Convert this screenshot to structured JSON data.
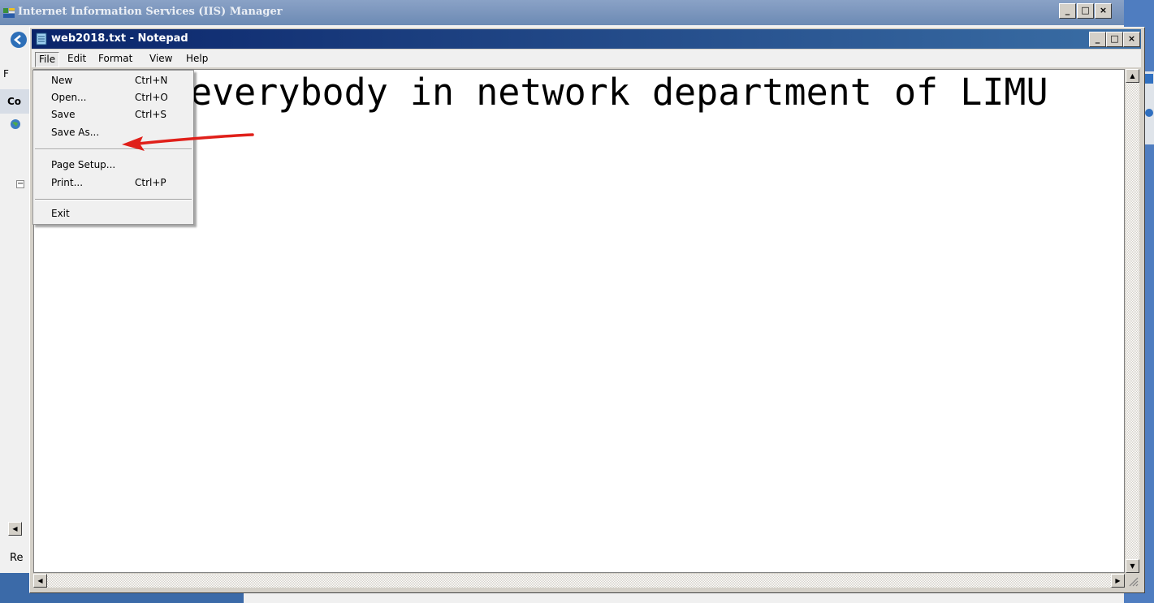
{
  "iis": {
    "title": "Internet Information Services (IIS) Manager",
    "partial_labels": [
      "F",
      "Co",
      "Re"
    ]
  },
  "notepad": {
    "title": "web2018.txt - Notepad",
    "menu": [
      "File",
      "Edit",
      "Format",
      "View",
      "Help"
    ],
    "content": "everybody in network department of LIMU"
  },
  "file_menu": {
    "items": [
      {
        "label": "New",
        "shortcut": "Ctrl+N"
      },
      {
        "label": "Open...",
        "shortcut": "Ctrl+O"
      },
      {
        "label": "Save",
        "shortcut": "Ctrl+S"
      },
      {
        "label": "Save As...",
        "shortcut": ""
      },
      {
        "label": "Page Setup...",
        "shortcut": ""
      },
      {
        "label": "Print...",
        "shortcut": "Ctrl+P"
      },
      {
        "label": "Exit",
        "shortcut": ""
      }
    ]
  },
  "caption_buttons": {
    "minimize": "_",
    "maximize": "□",
    "close": "×"
  },
  "annotation": {
    "color": "#e0201a",
    "icon": "red-arrow"
  }
}
